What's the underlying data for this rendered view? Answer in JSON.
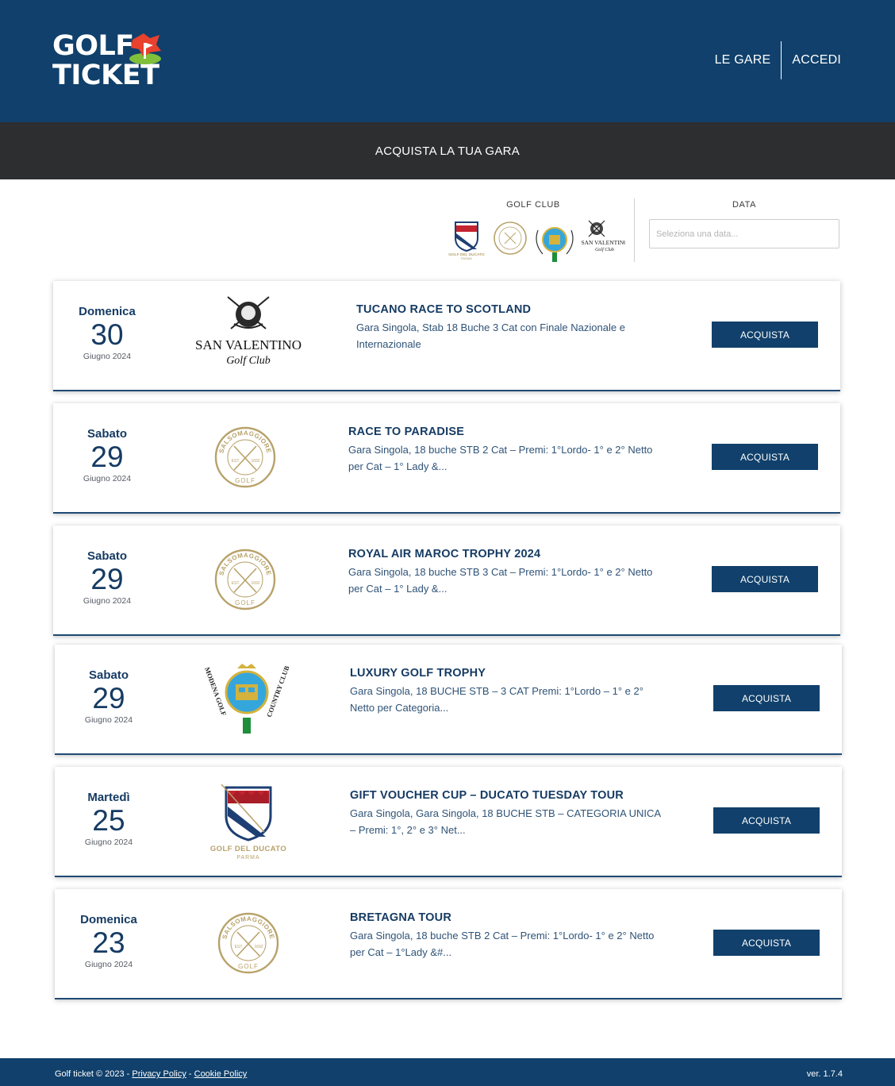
{
  "header": {
    "logo_line1": "GOLF",
    "logo_line2": "TICKET",
    "nav": [
      "LE GARE",
      "ACCEDI"
    ]
  },
  "subheader": {
    "title": "ACQUISTA LA TUA GARA"
  },
  "filters": {
    "club_label": "GOLF CLUB",
    "date_label": "DATA",
    "date_placeholder": "Seleziona una data..."
  },
  "logo_texts": {
    "ducato_name": "GOLF DEL DUCATO",
    "ducato_city": "PARMA",
    "salso_ring": "SALSOMAGGIORE",
    "salso_golf": "GOLF",
    "salso_est": "EST.",
    "salso_year": "1692",
    "sanv_line1": "SAN VALENTINO",
    "sanv_line2": "Golf Club",
    "modena_left": "MODENA GOLF",
    "modena_right": "COUNTRY CLUB"
  },
  "events": [
    {
      "weekday": "Domenica",
      "day": "30",
      "month": "Giugno 2024",
      "club": "san-valentino",
      "title": "TUCANO RACE TO SCOTLAND",
      "desc": "Gara Singola,  Stab 18 Buche 3 Cat con Finale Nazionale e Internazionale",
      "button": "ACQUISTA"
    },
    {
      "weekday": "Sabato",
      "day": "29",
      "month": "Giugno 2024",
      "club": "salsomaggiore",
      "title": "RACE TO PARADISE",
      "desc": "Gara Singola, 18 buche STB 2 Cat – Premi: 1°Lordo- 1° e 2° Netto per Cat – 1° Lady &...",
      "button": "ACQUISTA"
    },
    {
      "weekday": "Sabato",
      "day": "29",
      "month": "Giugno 2024",
      "club": "salsomaggiore",
      "title": "ROYAL AIR MAROC TROPHY 2024",
      "desc": "Gara Singola, 18 buche STB 3 Cat – Premi: 1°Lordo- 1° e 2° Netto per Cat – 1° Lady &...",
      "button": "ACQUISTA"
    },
    {
      "weekday": "Sabato",
      "day": "29",
      "month": "Giugno 2024",
      "club": "modena",
      "title": "LUXURY GOLF TROPHY",
      "desc": "Gara Singola, 18 BUCHE STB – 3 CAT Premi: 1°Lordo – 1° e 2° Netto per Categoria...",
      "button": "ACQUISTA"
    },
    {
      "weekday": "Martedì",
      "day": "25",
      "month": "Giugno 2024",
      "club": "ducato",
      "title": "GIFT VOUCHER CUP – DUCATO TUESDAY TOUR",
      "desc": "Gara Singola,  Gara Singola, 18 BUCHE STB – CATEGORIA UNICA – Premi: 1°, 2° e 3° Net...",
      "button": "ACQUISTA"
    },
    {
      "weekday": "Domenica",
      "day": "23",
      "month": "Giugno 2024",
      "club": "salsomaggiore",
      "title": "BRETAGNA TOUR",
      "desc": "Gara Singola, 18 buche STB 2 Cat – Premi: 1°Lordo- 1° e 2° Netto per Cat – 1°Lady &#...",
      "button": "ACQUISTA"
    }
  ],
  "footer": {
    "copyright": "Golf ticket © 2023 - ",
    "privacy": "Privacy Policy",
    "sep": " - ",
    "cookie": "Cookie Policy",
    "version": "ver. 1.7.4"
  },
  "colors": {
    "header_bg": "#10406b",
    "subheader_bg": "#2d2e30",
    "text_primary": "#163b63",
    "gold": "#b8a26a",
    "flag_red": "#e8412d",
    "flag_green": "#7fbf3a"
  }
}
